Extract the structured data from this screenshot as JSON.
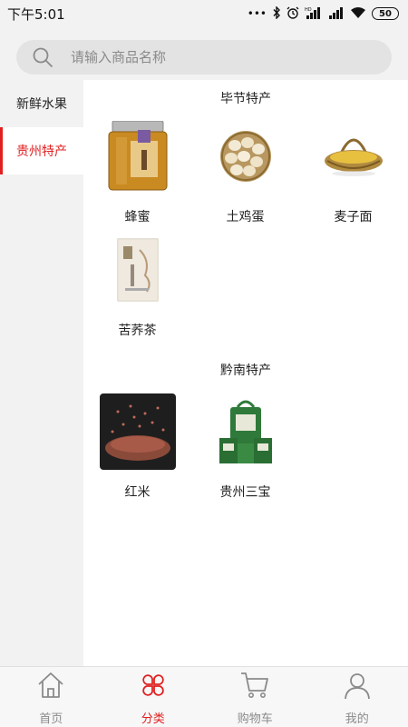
{
  "status_bar": {
    "time": "下午5:01",
    "network_label": "HD",
    "battery": "50"
  },
  "search": {
    "placeholder": "请输入商品名称"
  },
  "sidebar": {
    "items": [
      {
        "label": "新鲜水果",
        "active": false
      },
      {
        "label": "贵州特产",
        "active": true
      }
    ]
  },
  "sections": [
    {
      "title": "毕节特产",
      "products": [
        {
          "name": "蜂蜜",
          "icon": "honey-jar-image"
        },
        {
          "name": "土鸡蛋",
          "icon": "eggs-basket-image"
        },
        {
          "name": "麦子面",
          "icon": "wheat-basket-image"
        },
        {
          "name": "苦荞茶",
          "icon": "tea-box-image"
        }
      ]
    },
    {
      "title": "黔南特产",
      "products": [
        {
          "name": "红米",
          "icon": "red-rice-image"
        },
        {
          "name": "贵州三宝",
          "icon": "gift-bags-image"
        }
      ]
    }
  ],
  "bottom_nav": {
    "items": [
      {
        "label": "首页",
        "icon": "home-icon",
        "active": false
      },
      {
        "label": "分类",
        "icon": "category-icon",
        "active": true
      },
      {
        "label": "购物车",
        "icon": "cart-icon",
        "active": false
      },
      {
        "label": "我的",
        "icon": "profile-icon",
        "active": false
      }
    ]
  },
  "colors": {
    "accent": "#e02020",
    "background": "#f2f2f2",
    "inactive": "#8a8a8a"
  }
}
